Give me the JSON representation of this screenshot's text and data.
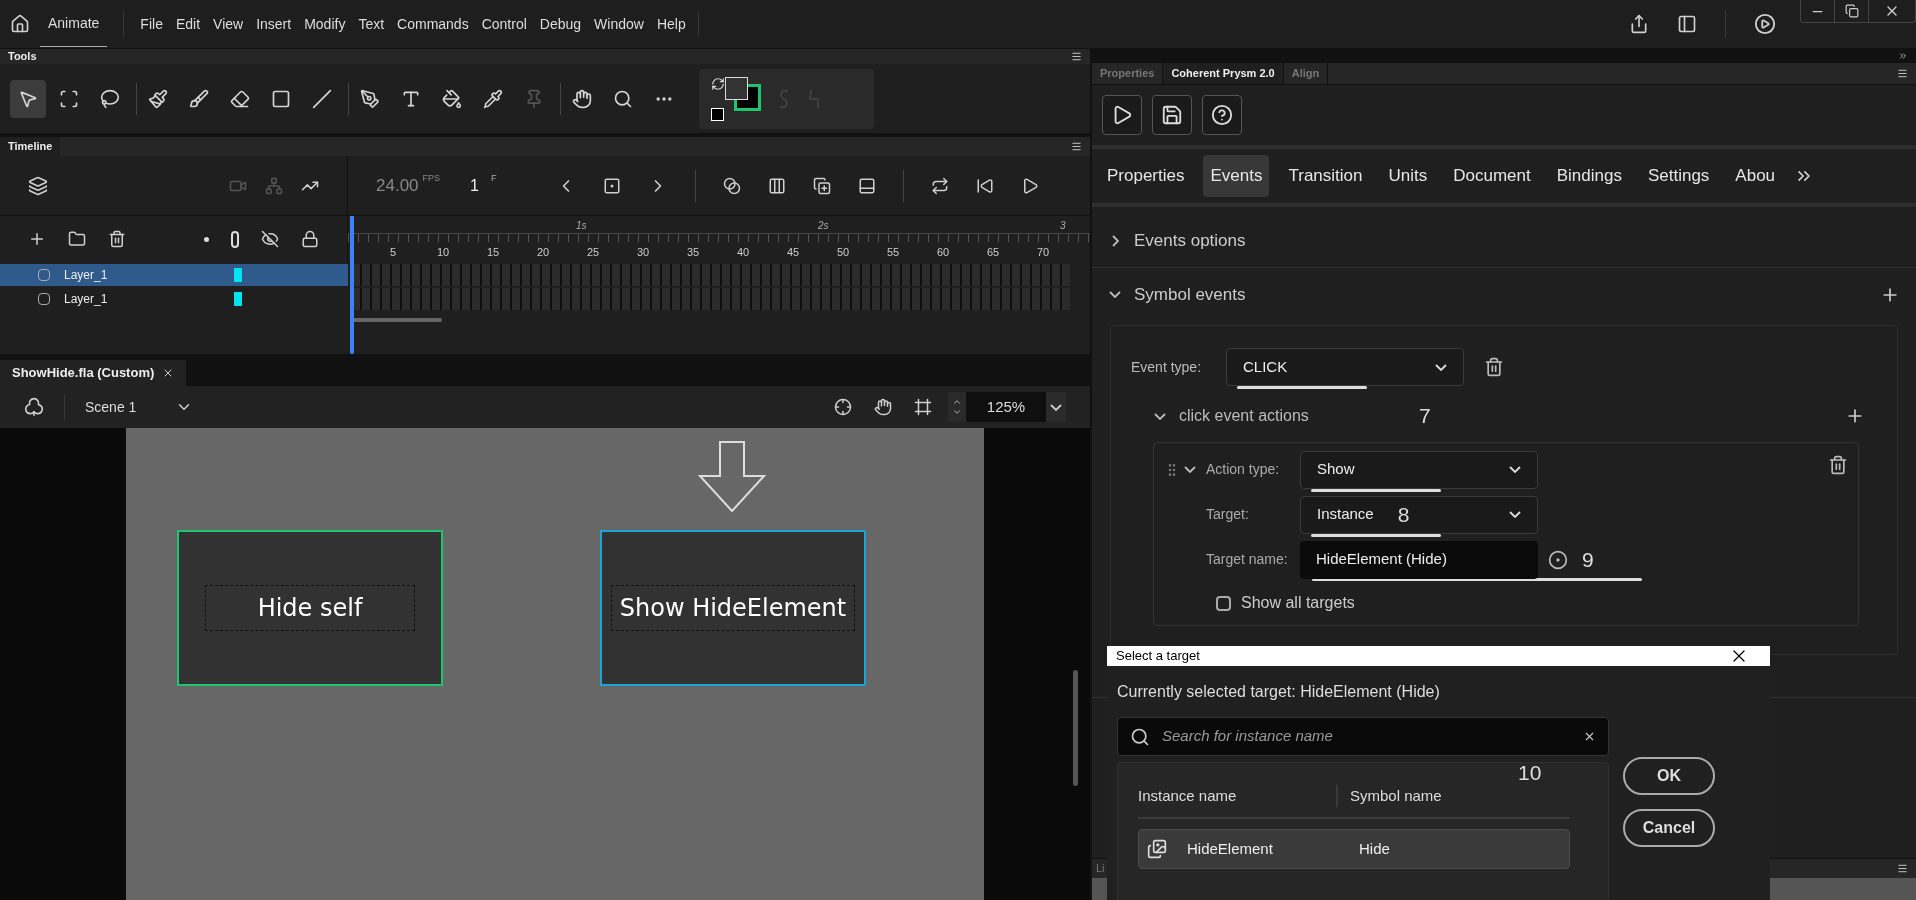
{
  "app": {
    "name": "Animate"
  },
  "menu": [
    "File",
    "Edit",
    "View",
    "Insert",
    "Modify",
    "Text",
    "Commands",
    "Control",
    "Debug",
    "Window",
    "Help"
  ],
  "tools": {
    "title": "Tools",
    "items": [
      {
        "kind": "select",
        "selected": true
      },
      {
        "kind": "transform",
        "selected": false
      },
      {
        "kind": "lasso",
        "selected": false
      },
      {
        "kind": "paint-brush",
        "selected": false
      },
      {
        "kind": "brush",
        "selected": false
      },
      {
        "kind": "eraser",
        "selected": false
      },
      {
        "kind": "rectangle",
        "selected": false
      },
      {
        "kind": "line",
        "selected": false
      },
      {
        "kind": "pen",
        "selected": false
      },
      {
        "kind": "text",
        "selected": false
      },
      {
        "kind": "bucket",
        "selected": false
      },
      {
        "kind": "eyedropper",
        "selected": false
      },
      {
        "kind": "pin",
        "selected": false
      },
      {
        "kind": "hand",
        "selected": false
      },
      {
        "kind": "zoom",
        "selected": false
      },
      {
        "kind": "more",
        "selected": false
      }
    ]
  },
  "timeline": {
    "title": "Timeline",
    "fps": "24.00",
    "fps_unit": "FPS",
    "frame": "1",
    "frame_unit": "F",
    "time_marks": [
      "1s",
      "2s",
      "3"
    ],
    "frame_numbers": [
      "5",
      "10",
      "15",
      "20",
      "25",
      "30",
      "35",
      "40",
      "45",
      "50",
      "55",
      "60",
      "65",
      "70"
    ],
    "layers": [
      {
        "name": "Layer_1",
        "selected": true
      },
      {
        "name": "Layer_1",
        "selected": false
      }
    ]
  },
  "document": {
    "tab": "ShowHide.fla (Custom)",
    "scene": "Scene 1",
    "zoom": "125%"
  },
  "stage": {
    "buttons": [
      {
        "label": "Hide self",
        "color": "#1ec46e"
      },
      {
        "label": "Show HideElement",
        "color": "#1aa6d6"
      }
    ]
  },
  "panel_tabs": [
    {
      "label": "Properties",
      "selected": false
    },
    {
      "label": "Coherent Prysm 2.0",
      "selected": true
    },
    {
      "label": "Align",
      "selected": false
    }
  ],
  "plugin_tabs": [
    {
      "label": "Properties",
      "selected": false
    },
    {
      "label": "Events",
      "selected": true
    },
    {
      "label": "Transition",
      "selected": false
    },
    {
      "label": "Units",
      "selected": false
    },
    {
      "label": "Document",
      "selected": false
    },
    {
      "label": "Bindings",
      "selected": false
    },
    {
      "label": "Settings",
      "selected": false
    },
    {
      "label": "Abou",
      "selected": false
    }
  ],
  "sections": [
    {
      "title": "Events options",
      "expanded": false
    },
    {
      "title": "Symbol events",
      "expanded": true
    }
  ],
  "event_type": {
    "label": "Event type:",
    "value": "CLICK"
  },
  "actions": {
    "title": "click event actions",
    "expanded": true,
    "annotation": "7"
  },
  "action": {
    "expanded": true,
    "fields": [
      {
        "kind": "select",
        "label": "Action type:",
        "value": "Show"
      },
      {
        "kind": "select",
        "label": "Target:",
        "value": "Instance",
        "annotation": "8"
      },
      {
        "kind": "input",
        "label": "Target name:",
        "value": "HideElement (Hide)",
        "annotation": "9"
      }
    ],
    "show_all": {
      "label": "Show all targets",
      "checked": false
    }
  },
  "dialog": {
    "title": "Select a target",
    "current": "Currently selected target: HideElement (Hide)",
    "search_placeholder": "Search for instance name",
    "annotation": "10",
    "columns": [
      "Instance name",
      "Symbol name"
    ],
    "rows": [
      {
        "instance": "HideElement",
        "symbol": "Hide",
        "selected": true
      }
    ],
    "buttons": [
      "OK",
      "Cancel"
    ]
  },
  "bottom_panel": {
    "tab": "Li"
  }
}
